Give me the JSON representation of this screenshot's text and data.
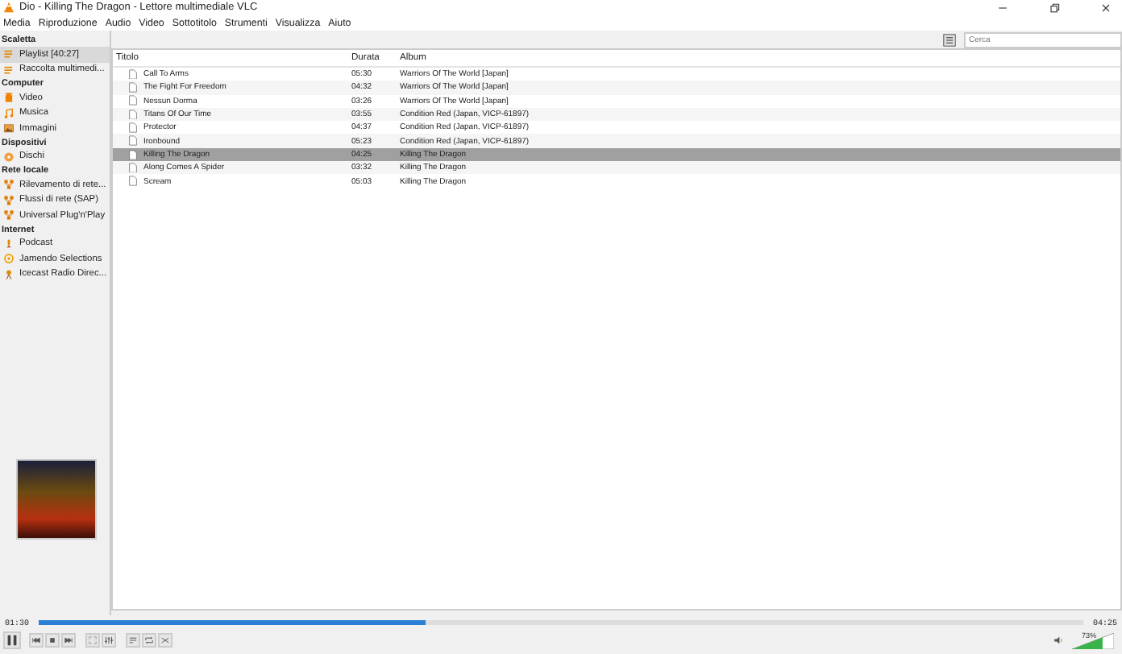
{
  "window": {
    "title": "Dio - Killing The Dragon - Lettore multimediale VLC"
  },
  "menu": [
    "Media",
    "Riproduzione",
    "Audio",
    "Video",
    "Sottotitolo",
    "Strumenti",
    "Visualizza",
    "Aiuto"
  ],
  "search": {
    "placeholder": "Cerca"
  },
  "sidebar": [
    {
      "heading": "Scaletta",
      "items": [
        {
          "label": "Playlist [40:27]",
          "kind": "playlist",
          "selected": true
        },
        {
          "label": "Raccolta multimedi...",
          "kind": "library",
          "selected": false
        }
      ]
    },
    {
      "heading": "Computer",
      "items": [
        {
          "label": "Video",
          "kind": "video",
          "selected": false
        },
        {
          "label": "Musica",
          "kind": "music",
          "selected": false
        },
        {
          "label": "Immagini",
          "kind": "images",
          "selected": false
        }
      ]
    },
    {
      "heading": "Dispositivi",
      "items": [
        {
          "label": "Dischi",
          "kind": "disc",
          "selected": false
        }
      ]
    },
    {
      "heading": "Rete locale",
      "items": [
        {
          "label": "Rilevamento di rete...",
          "kind": "network",
          "selected": false
        },
        {
          "label": "Flussi di rete (SAP)",
          "kind": "network",
          "selected": false
        },
        {
          "label": "Universal Plug'n'Play",
          "kind": "network",
          "selected": false
        }
      ]
    },
    {
      "heading": "Internet",
      "items": [
        {
          "label": "Podcast",
          "kind": "podcast",
          "selected": false
        },
        {
          "label": "Jamendo Selections",
          "kind": "jamendo",
          "selected": false
        },
        {
          "label": "Icecast Radio Direc...",
          "kind": "radio",
          "selected": false
        }
      ]
    }
  ],
  "table": {
    "columns": [
      "Titolo",
      "Durata",
      "Album"
    ],
    "rows": [
      {
        "title": "Call To Arms",
        "duration": "05:30",
        "album": "Warriors Of The World [Japan]",
        "selected": false
      },
      {
        "title": "The Fight For Freedom",
        "duration": "04:32",
        "album": "Warriors Of The World [Japan]",
        "selected": false
      },
      {
        "title": "Nessun Dorma",
        "duration": "03:26",
        "album": "Warriors Of The World [Japan]",
        "selected": false
      },
      {
        "title": "Titans Of Our Time",
        "duration": "03:55",
        "album": "Condition Red (Japan, VICP-61897)",
        "selected": false
      },
      {
        "title": "Protector",
        "duration": "04:37",
        "album": "Condition Red (Japan, VICP-61897)",
        "selected": false
      },
      {
        "title": "Ironbound",
        "duration": "05:23",
        "album": "Condition Red (Japan, VICP-61897)",
        "selected": false
      },
      {
        "title": "Killing The Dragon",
        "duration": "04:25",
        "album": "Killing The Dragon",
        "selected": true
      },
      {
        "title": "Along Comes A Spider",
        "duration": "03:32",
        "album": "Killing The Dragon",
        "selected": false
      },
      {
        "title": "Scream",
        "duration": "05:03",
        "album": "Killing The Dragon",
        "selected": false
      }
    ]
  },
  "player": {
    "elapsed": "01:30",
    "total": "04:25",
    "progress": {
      "level": 0.37
    },
    "volume": {
      "level": 0.73,
      "reading": "73%"
    }
  }
}
